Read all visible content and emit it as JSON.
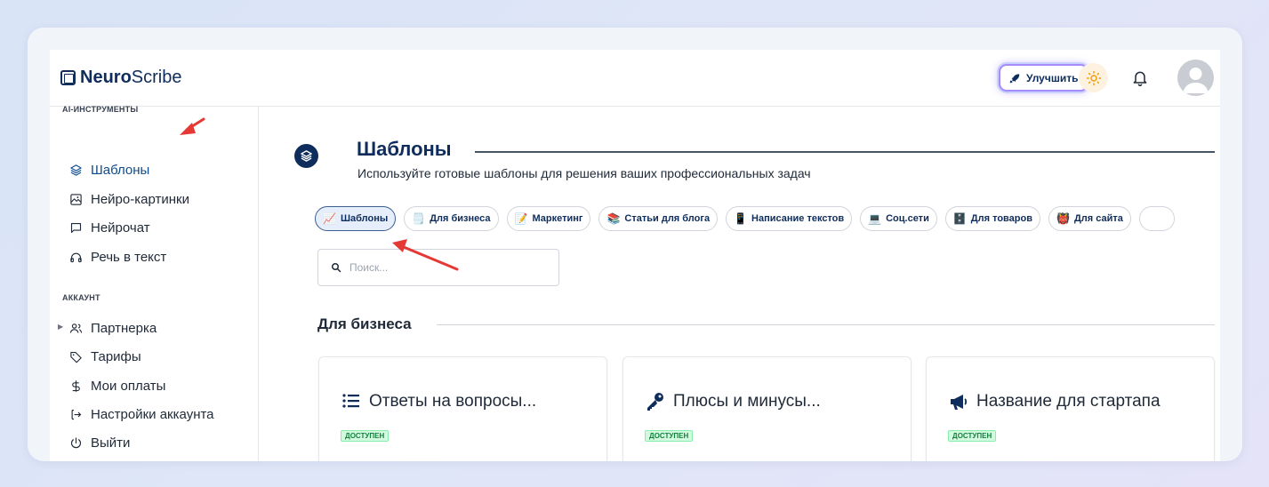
{
  "app": {
    "logo_bold": "Neuro",
    "logo_light": "Scribe"
  },
  "header": {
    "upgrade_label": "Улучшить"
  },
  "sidebar": {
    "section_tools": "AI-ИНСТРУМЕНТЫ",
    "tools": [
      {
        "label": "Шаблоны",
        "icon": "layers-icon",
        "active": true
      },
      {
        "label": "Нейро-картинки",
        "icon": "image-icon"
      },
      {
        "label": "Нейрочат",
        "icon": "chat-icon"
      },
      {
        "label": "Речь в текст",
        "icon": "headphones-icon"
      }
    ],
    "section_account": "АККАУНТ",
    "account": [
      {
        "label": "Партнерка",
        "icon": "users-icon"
      },
      {
        "label": "Тарифы",
        "icon": "tag-icon"
      },
      {
        "label": "Мои оплаты",
        "icon": "dollar-icon"
      },
      {
        "label": "Настройки аккаунта",
        "icon": "login-icon"
      },
      {
        "label": "Выйти",
        "icon": "power-icon"
      }
    ]
  },
  "page": {
    "title": "Шаблоны",
    "subtitle": "Используйте готовые шаблоны для решения ваших профессиональных задач",
    "search_placeholder": "Поиск...",
    "section_title": "Для бизнеса"
  },
  "chips": [
    {
      "emoji": "📈",
      "label": "Шаблоны",
      "active": true
    },
    {
      "emoji": "🗒️",
      "label": "Для бизнеса"
    },
    {
      "emoji": "📝",
      "label": "Маркетинг"
    },
    {
      "emoji": "📚",
      "label": "Статьи для блога"
    },
    {
      "emoji": "📱",
      "label": "Написание текстов"
    },
    {
      "emoji": "💻",
      "label": "Соц.сети"
    },
    {
      "emoji": "🗄️",
      "label": "Для товаров"
    },
    {
      "emoji": "👹",
      "label": "Для сайта"
    }
  ],
  "cards": [
    {
      "title": "Ответы на вопросы...",
      "icon": "list-icon",
      "badge": "ДОСТУПЕН"
    },
    {
      "title": "Плюсы и минусы...",
      "icon": "key-icon",
      "badge": "ДОСТУПЕН"
    },
    {
      "title": "Название для стартапа",
      "icon": "megaphone-icon",
      "badge": "ДОСТУПЕН"
    }
  ],
  "colors": {
    "brand": "#0f2d5c",
    "accent_purple": "#a78bfa",
    "badge_green": "#15803d",
    "annotation_red": "#e53935"
  }
}
